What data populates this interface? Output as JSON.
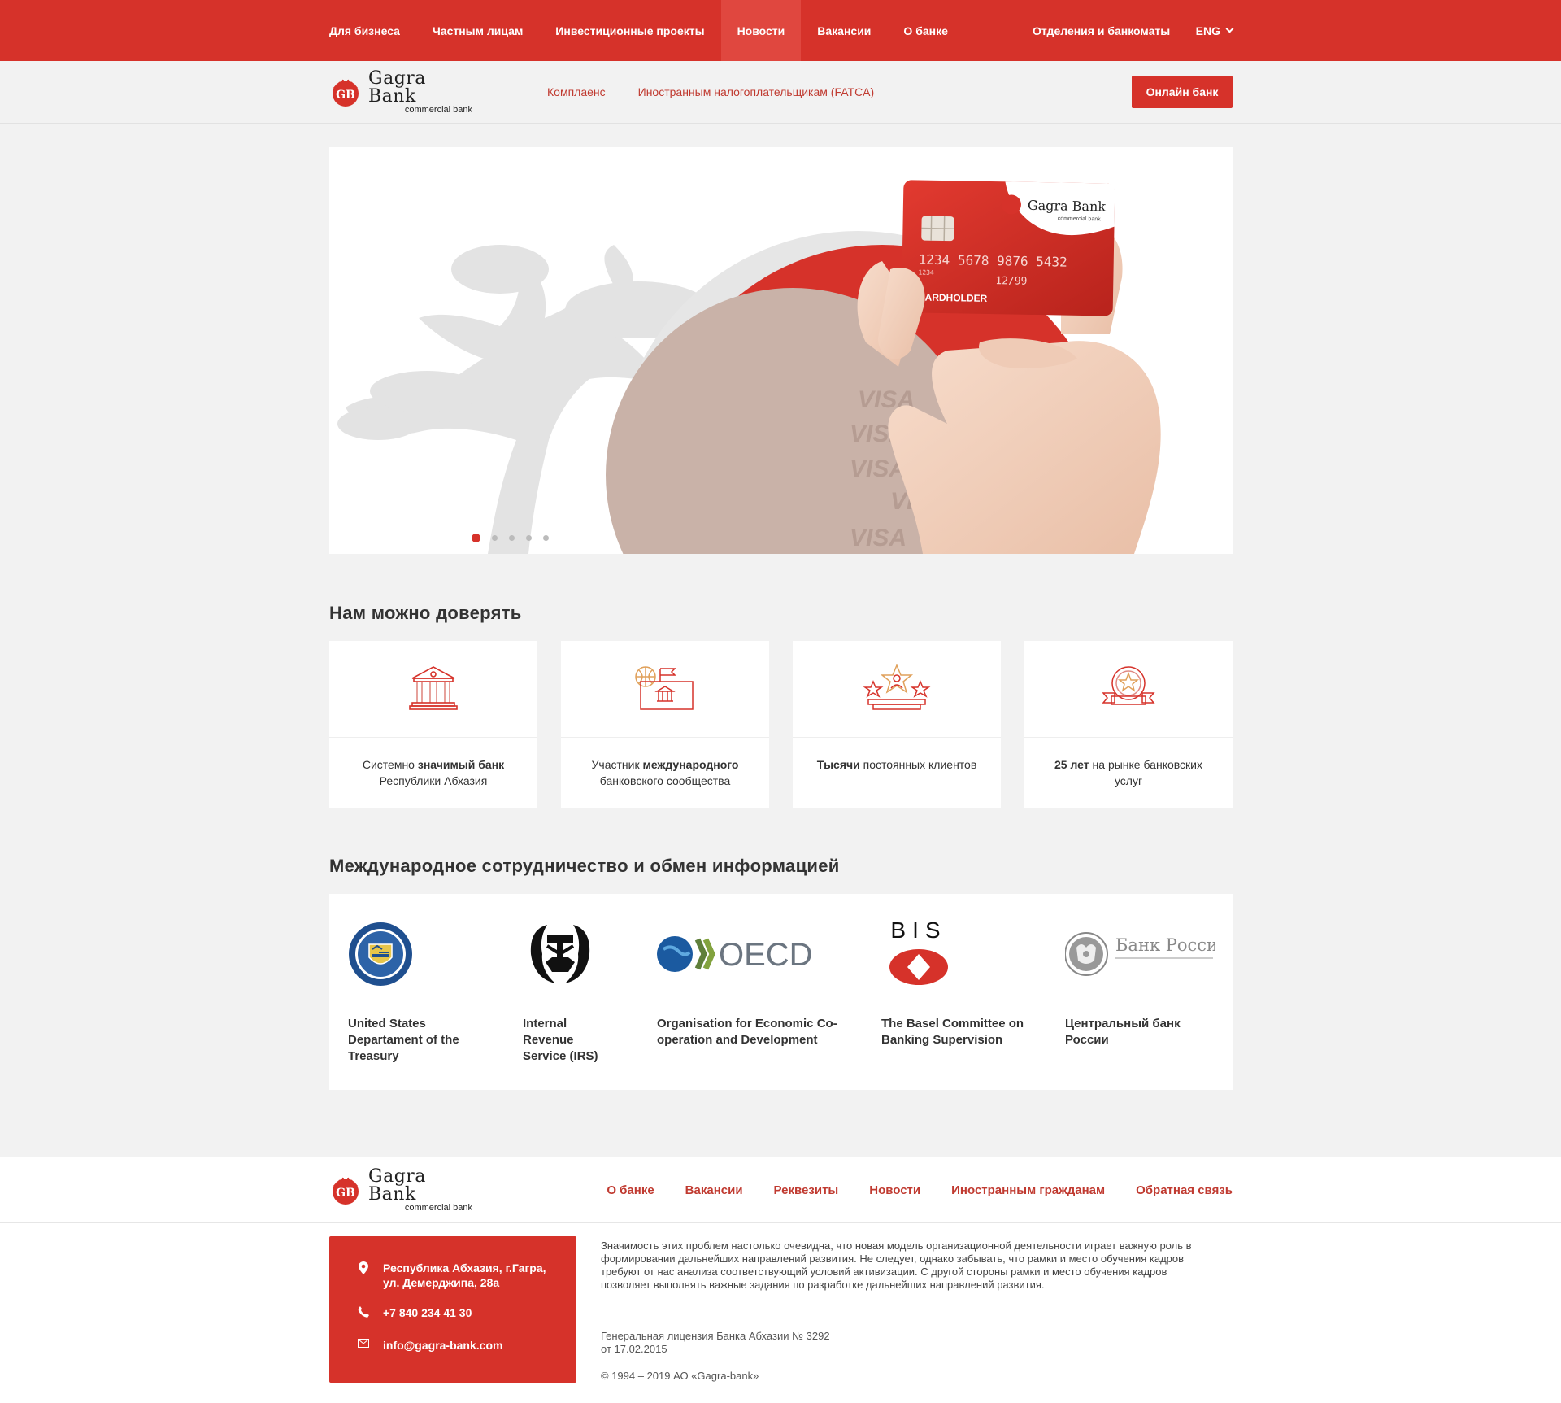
{
  "topnav": {
    "items": [
      {
        "label": "Для бизнеса"
      },
      {
        "label": "Частным лицам"
      },
      {
        "label": "Инвестиционные проекты"
      },
      {
        "label": "Новости",
        "active": true
      },
      {
        "label": "Вакансии"
      },
      {
        "label": "О банке"
      }
    ],
    "branches": "Отделения и банкоматы",
    "lang": "ENG"
  },
  "logo": {
    "name": "Gagra Bank",
    "sub": "commercial bank",
    "mark": "GB"
  },
  "subheader": {
    "links": [
      "Комплаенс",
      "Иностранным налогоплательщикам (FATCA)"
    ],
    "online_bank": "Онлайн банк"
  },
  "hero": {
    "card": {
      "brand": "Gagra Bank",
      "brand_sub": "commercial bank",
      "number": "1234 5678 9876 5432",
      "number_small": "1234",
      "expiry": "12/99",
      "holder": "CARDHOLDER"
    },
    "watermark": "VISA",
    "slides_total": 5,
    "active_slide": 1
  },
  "trust": {
    "title": "Нам можно доверять",
    "cards": [
      {
        "icon": "bank-building-icon",
        "pre": "Системно ",
        "bold": "значимый банк",
        "post": "Республики Абхазия"
      },
      {
        "icon": "globe-bank-icon",
        "pre": "Участник ",
        "bold": "международного",
        "post": "банковского сообщества"
      },
      {
        "icon": "stars-person-icon",
        "pre": "",
        "bold": "Тысячи",
        "post": " постоянных клиентов"
      },
      {
        "icon": "award-badge-icon",
        "pre": "",
        "bold": "25 лет",
        "post": " на рынке банковских услуг"
      }
    ]
  },
  "intl": {
    "title": "Международное сотрудничество и обмен информацией",
    "partners": [
      {
        "name": "United States Departament of the Treasury",
        "logo": "treasury-seal-icon"
      },
      {
        "name": "Internal Revenue Service (IRS)",
        "logo": "irs-eagle-icon"
      },
      {
        "name": "Organisation for Economic Co-operation and Development",
        "logo": "oecd-logo",
        "logo_text": "OECD"
      },
      {
        "name": "The Basel Committee on Banking Supervision",
        "logo": "bis-logo",
        "logo_text": "BIS"
      },
      {
        "name": "Центральный банк России",
        "logo": "bank-of-russia-logo",
        "logo_text": "Банк России"
      }
    ]
  },
  "footer": {
    "links": [
      "О банке",
      "Вакансии",
      "Реквезиты",
      "Новости",
      "Иностранным гражданам",
      "Обратная связь"
    ],
    "address_line1": "Республика Абхазия, г.Гагра,",
    "address_line2": "ул. Демерджипа, 28а",
    "phone": "+7 840 234 41 30",
    "email": "info@gagra-bank.com",
    "text": "Значимость этих проблем настолько очевидна, что новая модель организационной деятельности играет важную роль в формировании дальнейших направлений развития. Не следует, однако забывать, что рамки и место обучения кадров требуют от нас анализа соответствующий условий активизации. С другой стороны рамки и место обучения кадров позволяет выполнять важные задания по разработке дальнейших направлений развития.",
    "license_line1": "Генеральная лицензия Банка Абхазии № 3292",
    "license_line2": "от 17.02.2015",
    "copyright": "© 1994 – 2019 АО «Gagra-bank»"
  },
  "colors": {
    "brand": "#d6322a",
    "link": "#c03a30",
    "background": "#f2f2f2"
  }
}
